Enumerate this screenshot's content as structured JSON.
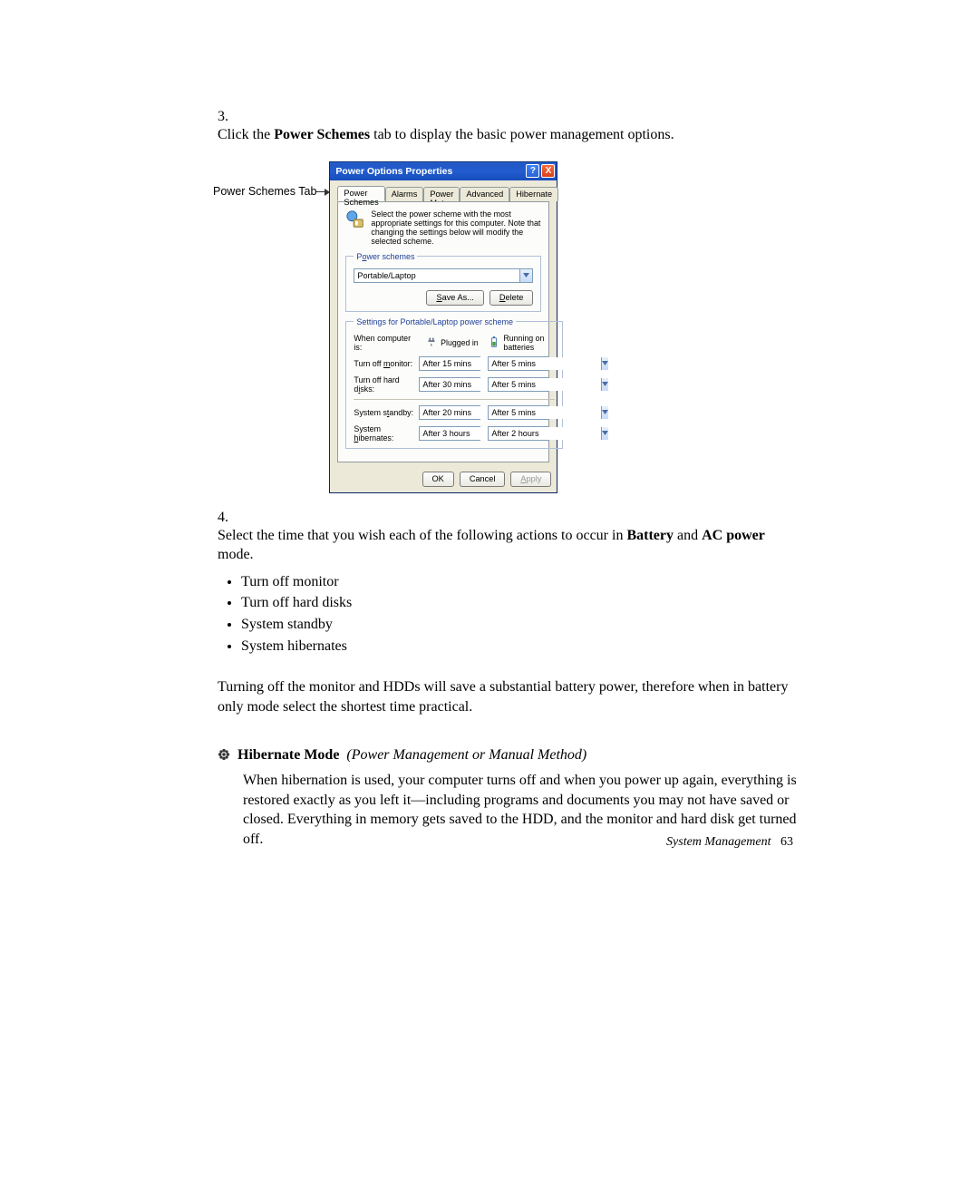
{
  "steps": {
    "s3": {
      "num": "3.",
      "prefix": "Click the ",
      "bold": "Power Schemes",
      "suffix": " tab to display the basic power management options."
    },
    "s4": {
      "num": "4.",
      "prefix": "Select the time that you wish each of the following actions to occur in ",
      "bold1": "Battery",
      "mid": " and ",
      "bold2": "AC power",
      "suffix": " mode.",
      "bullets": [
        "Turn off monitor",
        "Turn off hard disks",
        "System standby",
        "System hibernates"
      ]
    }
  },
  "annotation_label": "Power Schemes Tab",
  "dialog": {
    "title": "Power Options Properties",
    "help": "?",
    "close": "X",
    "tabs": [
      "Power Schemes",
      "Alarms",
      "Power Meter",
      "Advanced",
      "Hibernate"
    ],
    "desc": "Select the power scheme with the most appropriate settings for this computer. Note that changing the settings below will modify the selected scheme.",
    "fs1_legend_pre": "P",
    "fs1_legend_u": "o",
    "fs1_legend_post": "wer schemes",
    "scheme": "Portable/Laptop",
    "save_u": "S",
    "save_post": "ave As...",
    "delete_u": "D",
    "delete_post": "elete",
    "fs2_legend": "Settings for Portable/Laptop power scheme",
    "headers": {
      "when": "When computer is:",
      "plugged": "Plugged in",
      "battery": "Running on batteries"
    },
    "rows": {
      "monitor": {
        "label_pre": "Turn off ",
        "label_u": "m",
        "label_post": "onitor:",
        "ac": "After 15 mins",
        "batt": "After 5 mins"
      },
      "disks": {
        "label_pre": "Turn off hard d",
        "label_u": "i",
        "label_post": "sks:",
        "ac": "After 30 mins",
        "batt": "After 5 mins"
      },
      "standby": {
        "label_pre": "System s",
        "label_u": "t",
        "label_post": "andby:",
        "ac": "After 20 mins",
        "batt": "After 5 mins"
      },
      "hibernate": {
        "label_pre": "System ",
        "label_u": "h",
        "label_post": "ibernates:",
        "ac": "After 3 hours",
        "batt": "After 2 hours"
      }
    },
    "buttons": {
      "ok": "OK",
      "cancel": "Cancel",
      "apply_pre": "",
      "apply_u": "A",
      "apply_post": "pply"
    }
  },
  "para_after": "Turning off the monitor and HDDs will save a substantial battery power, therefore when in battery only mode select the shortest time practical.",
  "hibernate": {
    "title": "Hibernate Mode",
    "paren": "(Power Management or Manual Method)",
    "body": "When hibernation is used, your computer turns off and when you power up again, everything is restored exactly as you left it—including programs and documents you may not have saved or closed. Everything in memory gets saved to the HDD, and the monitor and hard disk get turned off."
  },
  "footer": {
    "label": "System Management",
    "page": "63"
  }
}
